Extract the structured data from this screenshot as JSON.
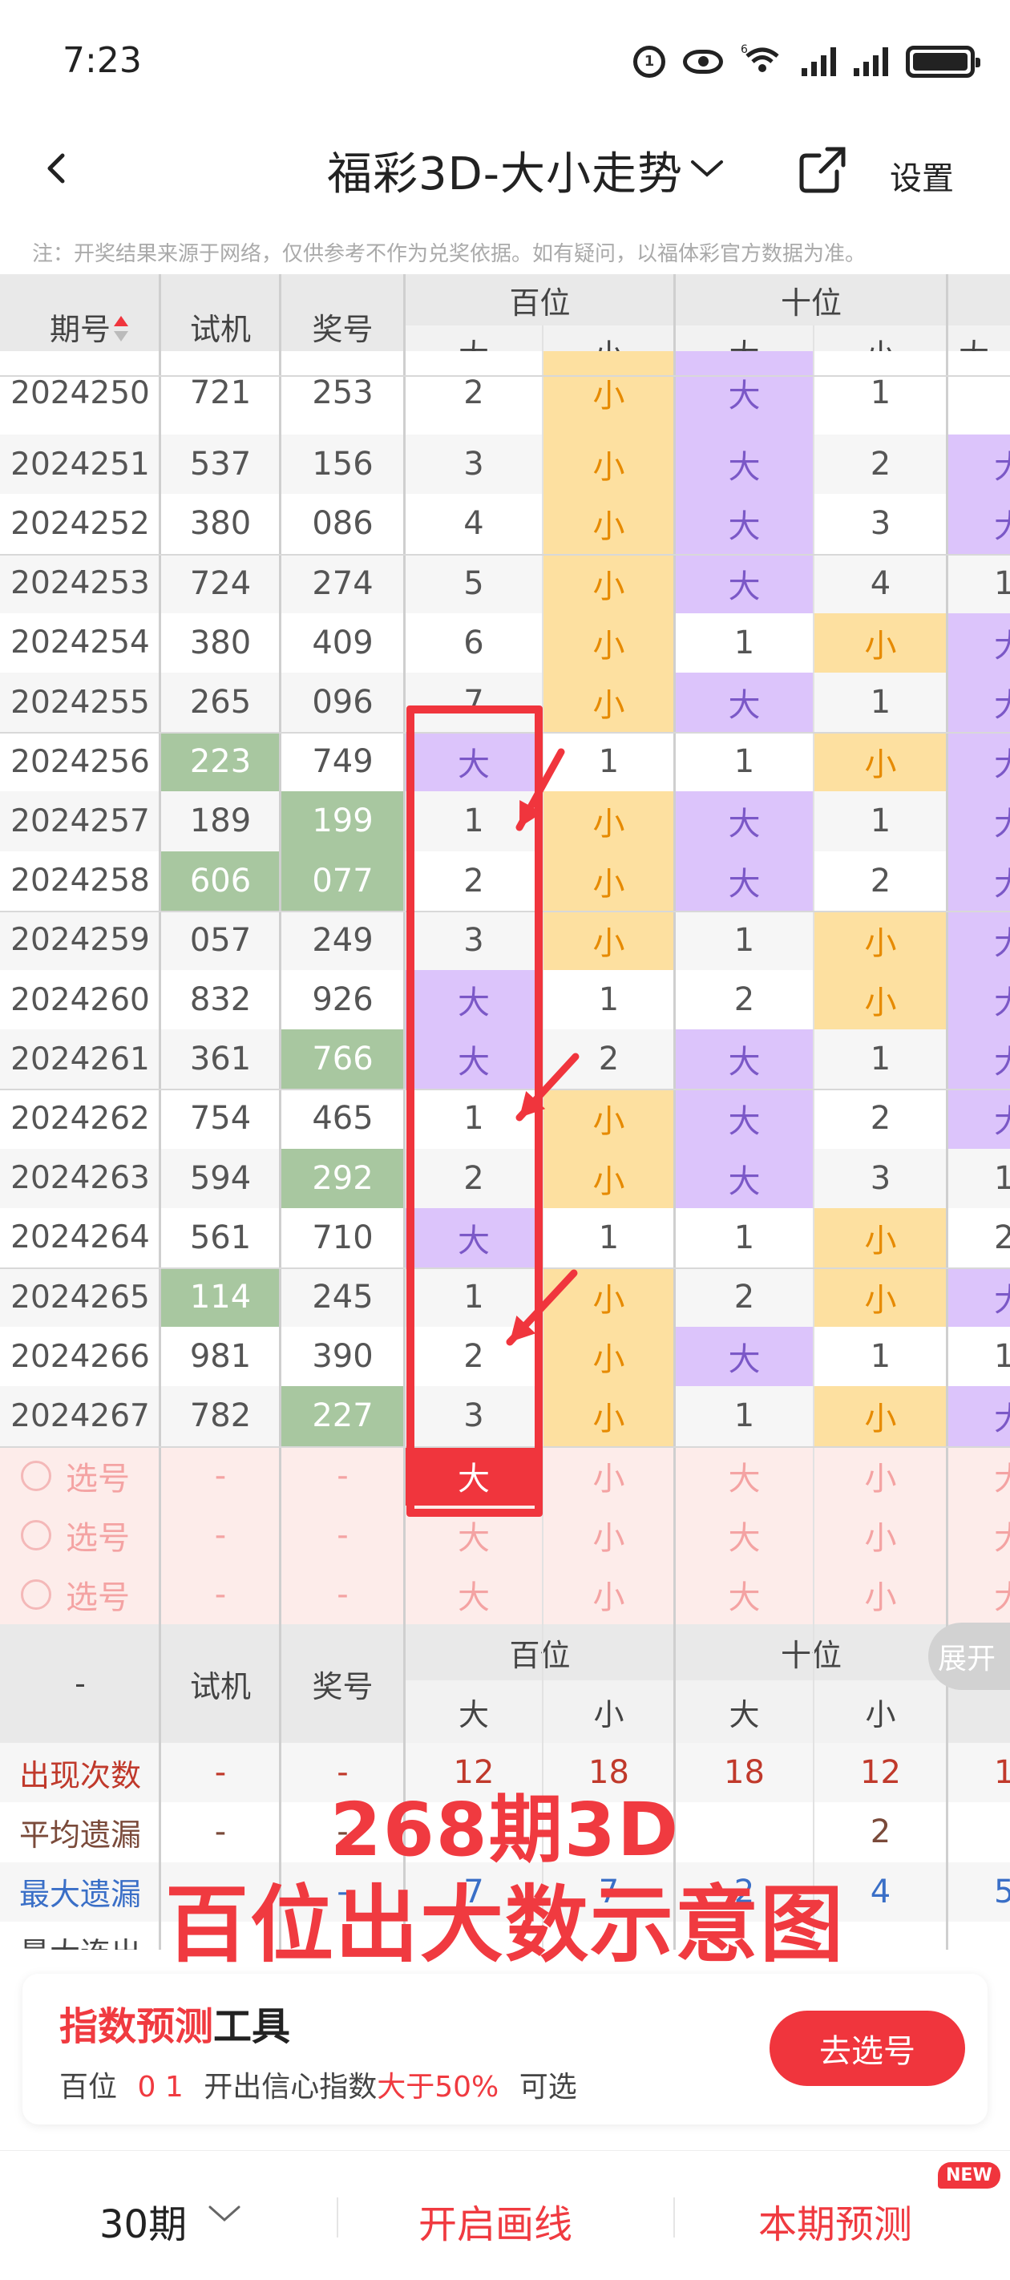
{
  "status_bar": {
    "time": "7:23",
    "circle_icon_text": "1",
    "network": "6"
  },
  "header": {
    "title": "福彩3D-大小走势",
    "settings_label": "设置"
  },
  "notice": "注：开奖结果来源于网络，仅供参考不作为兑奖依据。如有疑问，以福体彩官方数据为准。",
  "table_header": {
    "period": "期号",
    "trial": "试机",
    "prize": "奖号",
    "hundreds": "百位",
    "tens": "十位",
    "big": "大",
    "small": "小",
    "next_col_partial": "大"
  },
  "rows": [
    {
      "period": "2024250",
      "trial": "721",
      "prize": "253",
      "h_big": "2",
      "h_small": "小",
      "t_big": "大",
      "t_small": "1",
      "u": "",
      "trial_hl": false,
      "prize_hl": false
    },
    {
      "period": "2024251",
      "trial": "537",
      "prize": "156",
      "h_big": "3",
      "h_small": "小",
      "t_big": "大",
      "t_small": "2",
      "u": "大",
      "trial_hl": false,
      "prize_hl": false
    },
    {
      "period": "2024252",
      "trial": "380",
      "prize": "086",
      "h_big": "4",
      "h_small": "小",
      "t_big": "大",
      "t_small": "3",
      "u": "大",
      "trial_hl": false,
      "prize_hl": false
    },
    {
      "period": "2024253",
      "trial": "724",
      "prize": "274",
      "h_big": "5",
      "h_small": "小",
      "t_big": "大",
      "t_small": "4",
      "u": "1",
      "trial_hl": false,
      "prize_hl": false
    },
    {
      "period": "2024254",
      "trial": "380",
      "prize": "409",
      "h_big": "6",
      "h_small": "小",
      "t_big": "1",
      "t_small": "小",
      "u": "大",
      "trial_hl": false,
      "prize_hl": false
    },
    {
      "period": "2024255",
      "trial": "265",
      "prize": "096",
      "h_big": "7",
      "h_small": "小",
      "t_big": "大",
      "t_small": "1",
      "u": "大",
      "trial_hl": false,
      "prize_hl": false
    },
    {
      "period": "2024256",
      "trial": "223",
      "prize": "749",
      "h_big": "大",
      "h_small": "1",
      "t_big": "1",
      "t_small": "小",
      "u": "大",
      "trial_hl": true,
      "prize_hl": false
    },
    {
      "period": "2024257",
      "trial": "189",
      "prize": "199",
      "h_big": "1",
      "h_small": "小",
      "t_big": "大",
      "t_small": "1",
      "u": "大",
      "trial_hl": false,
      "prize_hl": true
    },
    {
      "period": "2024258",
      "trial": "606",
      "prize": "077",
      "h_big": "2",
      "h_small": "小",
      "t_big": "大",
      "t_small": "2",
      "u": "大",
      "trial_hl": true,
      "prize_hl": true
    },
    {
      "period": "2024259",
      "trial": "057",
      "prize": "249",
      "h_big": "3",
      "h_small": "小",
      "t_big": "1",
      "t_small": "小",
      "u": "大",
      "trial_hl": false,
      "prize_hl": false
    },
    {
      "period": "2024260",
      "trial": "832",
      "prize": "926",
      "h_big": "大",
      "h_small": "1",
      "t_big": "2",
      "t_small": "小",
      "u": "大",
      "trial_hl": false,
      "prize_hl": false
    },
    {
      "period": "2024261",
      "trial": "361",
      "prize": "766",
      "h_big": "大",
      "h_small": "2",
      "t_big": "大",
      "t_small": "1",
      "u": "大",
      "trial_hl": false,
      "prize_hl": true
    },
    {
      "period": "2024262",
      "trial": "754",
      "prize": "465",
      "h_big": "1",
      "h_small": "小",
      "t_big": "大",
      "t_small": "2",
      "u": "大",
      "trial_hl": false,
      "prize_hl": false
    },
    {
      "period": "2024263",
      "trial": "594",
      "prize": "292",
      "h_big": "2",
      "h_small": "小",
      "t_big": "大",
      "t_small": "3",
      "u": "1",
      "trial_hl": false,
      "prize_hl": true
    },
    {
      "period": "2024264",
      "trial": "561",
      "prize": "710",
      "h_big": "大",
      "h_small": "1",
      "t_big": "1",
      "t_small": "小",
      "u": "2",
      "trial_hl": false,
      "prize_hl": false
    },
    {
      "period": "2024265",
      "trial": "114",
      "prize": "245",
      "h_big": "1",
      "h_small": "小",
      "t_big": "2",
      "t_small": "小",
      "u": "大",
      "trial_hl": true,
      "prize_hl": false
    },
    {
      "period": "2024266",
      "trial": "981",
      "prize": "390",
      "h_big": "2",
      "h_small": "小",
      "t_big": "大",
      "t_small": "1",
      "u": "1",
      "trial_hl": false,
      "prize_hl": false
    },
    {
      "period": "2024267",
      "trial": "782",
      "prize": "227",
      "h_big": "3",
      "h_small": "小",
      "t_big": "1",
      "t_small": "小",
      "u": "大",
      "trial_hl": false,
      "prize_hl": true
    }
  ],
  "select_rows": [
    {
      "label": "选号",
      "trial": "-",
      "prize": "-",
      "h_big": "大",
      "h_small": "小",
      "t_big": "大",
      "t_small": "小",
      "u": "大",
      "selected": true
    },
    {
      "label": "选号",
      "trial": "-",
      "prize": "-",
      "h_big": "大",
      "h_small": "小",
      "t_big": "大",
      "t_small": "小",
      "u": "大",
      "selected": false
    },
    {
      "label": "选号",
      "trial": "-",
      "prize": "-",
      "h_big": "大",
      "h_small": "小",
      "t_big": "大",
      "t_small": "小",
      "u": "大",
      "selected": false
    }
  ],
  "stats_header": {
    "dash": "-",
    "trial": "试机",
    "prize": "奖号",
    "hundreds": "百位",
    "tens": "十位",
    "big": "大",
    "small": "小"
  },
  "expand_label": "展开",
  "stats": [
    {
      "label": "出现次数",
      "trial": "-",
      "prize": "-",
      "h_big": "12",
      "h_small": "18",
      "t_big": "18",
      "t_small": "12",
      "u": "1",
      "color": "#c0392b"
    },
    {
      "label": "平均遗漏",
      "trial": "-",
      "prize": "-",
      "h_big": "",
      "h_small": "",
      "t_big": "",
      "t_small": "2",
      "u": "",
      "color": "#7a4a3a"
    },
    {
      "label": "最大遗漏",
      "trial": "-",
      "prize": "-",
      "h_big": "7",
      "h_small": "7",
      "t_big": "2",
      "t_small": "4",
      "u": "5",
      "color": "#3a6fc7"
    },
    {
      "label": "最大连出",
      "trial": "-",
      "prize": "-",
      "h_big": "",
      "h_small": "",
      "t_big": "",
      "t_small": "",
      "u": "",
      "color": "#444"
    }
  ],
  "overlay": {
    "line1": "268期3D",
    "line2": "百位出大数示意图"
  },
  "tool": {
    "title_red": "指数预测",
    "title_dark": "工具",
    "desc_prefix": "百位",
    "desc_nums": "0 1",
    "desc_mid": "开出信心指数",
    "desc_red": "大于50%",
    "desc_suffix": "可选",
    "button": "去选号"
  },
  "bottom": {
    "period": "30期",
    "draw": "开启画线",
    "predict": "本期预测",
    "badge": "NEW"
  },
  "colors": {
    "accent_red": "#f0353d",
    "big_purple": "#dcc4fb",
    "small_yellow": "#fde0a0",
    "highlight_green": "#a8c7a0"
  }
}
